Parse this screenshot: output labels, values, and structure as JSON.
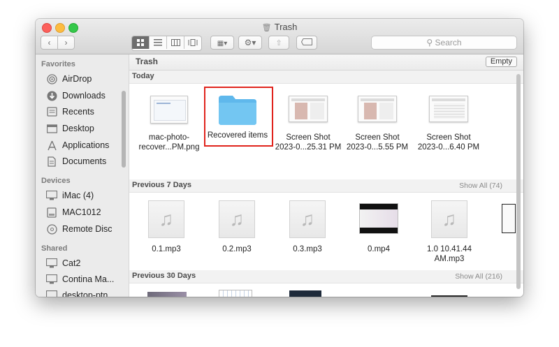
{
  "window": {
    "title": "Trash"
  },
  "toolbar": {
    "search_placeholder": "Search",
    "view_modes": [
      "icon-view",
      "list-view",
      "column-view",
      "cover-flow-view"
    ],
    "active_view": "icon-view"
  },
  "sidebar": {
    "favorites_header": "Favorites",
    "favorites": [
      {
        "label": "AirDrop",
        "icon": "airdrop-icon"
      },
      {
        "label": "Downloads",
        "icon": "downloads-icon"
      },
      {
        "label": "Recents",
        "icon": "recents-icon"
      },
      {
        "label": "Desktop",
        "icon": "desktop-icon"
      },
      {
        "label": "Applications",
        "icon": "applications-icon"
      },
      {
        "label": "Documents",
        "icon": "documents-icon"
      }
    ],
    "devices_header": "Devices",
    "devices": [
      {
        "label": "iMac (4)",
        "icon": "imac-icon"
      },
      {
        "label": "MAC1012",
        "icon": "disk-icon"
      },
      {
        "label": "Remote Disc",
        "icon": "disc-icon"
      }
    ],
    "shared_header": "Shared",
    "shared": [
      {
        "label": "Cat2",
        "icon": "monitor-icon"
      },
      {
        "label": "Contina Ma...",
        "icon": "monitor-icon"
      },
      {
        "label": "desktop-ptn...",
        "icon": "monitor-icon"
      }
    ]
  },
  "main": {
    "path_title": "Trash",
    "empty_label": "Empty",
    "groups": [
      {
        "title": "Today",
        "show_all": "",
        "items": [
          {
            "line1": "mac-photo-",
            "line2": "recover...PM.png",
            "kind": "screenshot"
          },
          {
            "line1": "Recovered items",
            "line2": "",
            "kind": "folder",
            "highlighted": true
          },
          {
            "line1": "Screen Shot",
            "line2": "2023-0...25.31 PM",
            "kind": "screenshot"
          },
          {
            "line1": "Screen Shot",
            "line2": "2023-0...5.55 PM",
            "kind": "screenshot"
          },
          {
            "line1": "Screen Shot",
            "line2": "2023-0...6.40 PM",
            "kind": "screenshot"
          }
        ]
      },
      {
        "title": "Previous 7 Days",
        "show_all": "Show All (74)",
        "items": [
          {
            "line1": "0.1.mp3",
            "line2": "",
            "kind": "audio"
          },
          {
            "line1": "0.2.mp3",
            "line2": "",
            "kind": "audio"
          },
          {
            "line1": "0.3.mp3",
            "line2": "",
            "kind": "audio"
          },
          {
            "line1": "0.mp4",
            "line2": "",
            "kind": "video"
          },
          {
            "line1": "1.0 10.41.44",
            "line2": "AM.mp3",
            "kind": "audio"
          }
        ]
      },
      {
        "title": "Previous 30 Days",
        "show_all": "Show All (216)",
        "items": []
      }
    ]
  }
}
